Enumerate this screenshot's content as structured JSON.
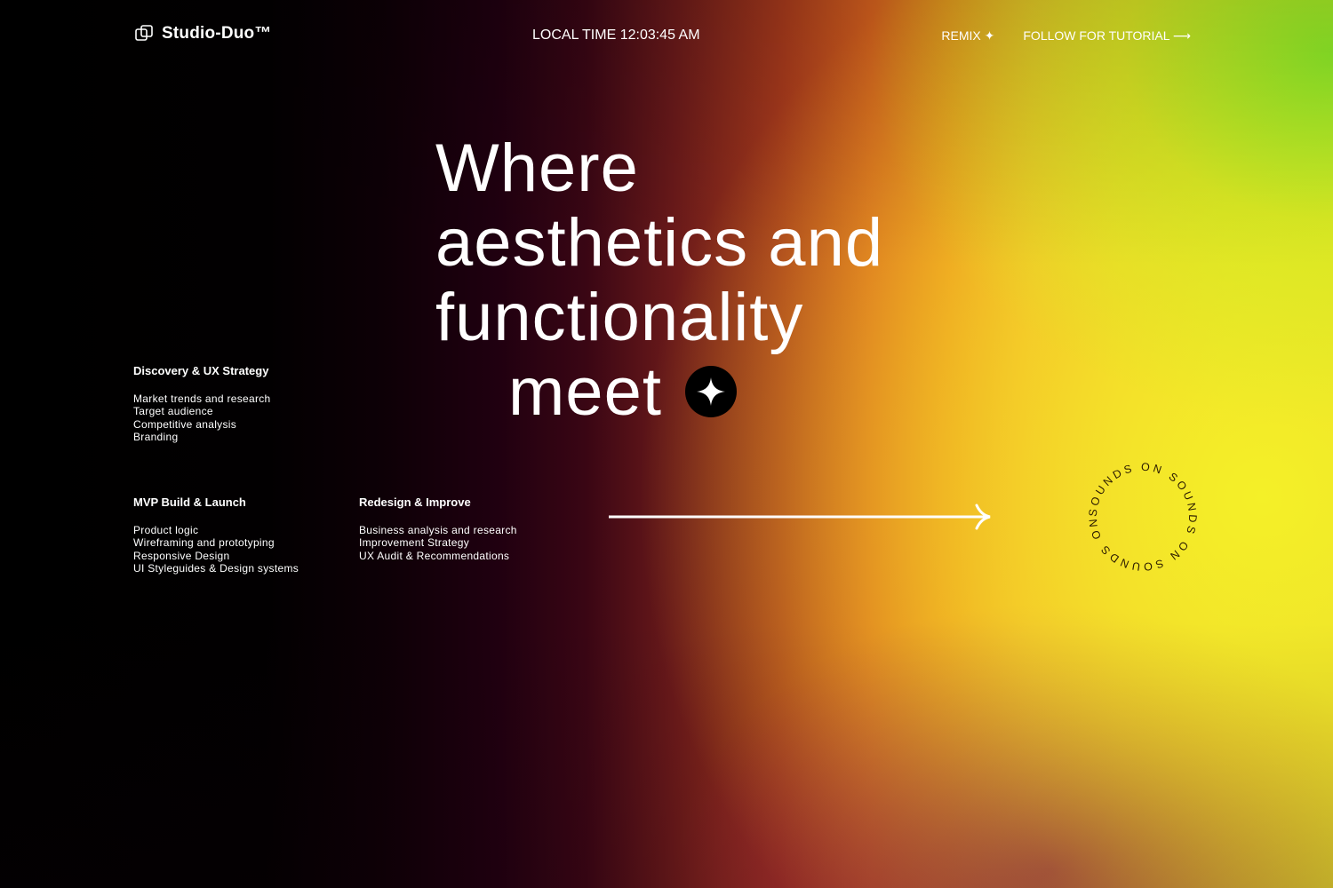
{
  "header": {
    "brand": "Studio-Duo™",
    "clock_label": "LOCAL TIME 12:03:45 AM",
    "nav": {
      "remix": "REMIX ✦",
      "follow": "FOLLOW FOR TUTORIAL ⟶"
    }
  },
  "hero": {
    "line1": "Where",
    "line2": "aesthetics and",
    "line3": "functionality",
    "line4": "meet"
  },
  "services": [
    {
      "title": "Discovery & UX Strategy",
      "items": [
        "Market trends and research",
        "Target audience",
        "Competitive analysis",
        "Branding"
      ]
    },
    {
      "title": "MVP Build & Launch",
      "items": [
        "Product logic",
        "Wireframing and prototyping",
        "Responsive Design",
        "UI Styleguides & Design systems"
      ]
    },
    {
      "title": "Redesign & Improve",
      "items": [
        "Business analysis and research",
        "Improvement Strategy",
        "UX Audit & Recommendations"
      ]
    }
  ],
  "sound_toggle": {
    "text": "SOUNDS ON SOUNDS ON SOUNDS ON "
  },
  "colors": {
    "text": "#ffffff",
    "background": "#000000",
    "accent_lime": "#a8f020",
    "accent_yellow": "#f0e02c",
    "accent_orange": "#e8741e",
    "accent_magenta": "#8c0a50",
    "sound_text": "#2a1a00"
  },
  "icons": {
    "logo": "studio-duo-logo-icon",
    "badge": "four-point-star-icon",
    "arrow": "long-right-arrow-icon"
  }
}
